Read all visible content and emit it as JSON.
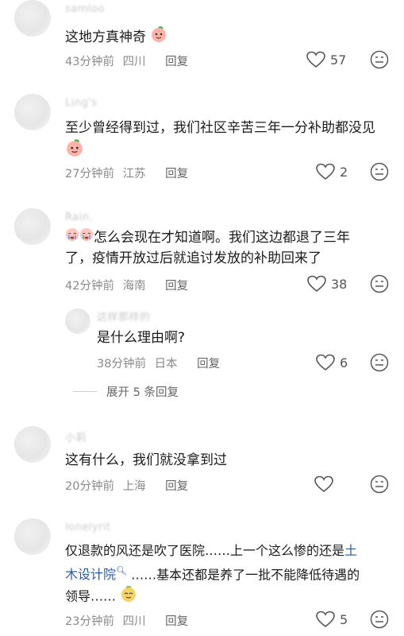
{
  "comments": [
    {
      "user": "samloo",
      "text": "这地方真神奇",
      "time": "43分钟前",
      "location": "四川",
      "reply": "回复",
      "likes": "57"
    },
    {
      "user": "Ling's",
      "text": "至少曾经得到过，我们社区辛苦三年一分补助都没见",
      "time": "27分钟前",
      "location": "江苏",
      "reply": "回复",
      "likes": "2"
    },
    {
      "user": "Rain.",
      "text_line1": "怎么会现在才知道啊。我们这边都退了三年",
      "text_line2": "了，疫情开放过后就追讨发放的补助回来了",
      "time": "42分钟前",
      "location": "海南",
      "reply": "回复",
      "likes": "38",
      "sub_reply": {
        "user": "这样那样的",
        "text": "是什么理由啊?",
        "time": "38分钟前",
        "location": "日本",
        "reply": "回复",
        "likes": "6"
      },
      "expand": "展开 5 条回复"
    },
    {
      "user": "小莉",
      "text": "这有什么，我们就没拿到过",
      "time": "20分钟前",
      "location": "上海",
      "reply": "回复",
      "likes": ""
    },
    {
      "user": "lonelyrit",
      "text_part1": "仅退款的风还是吹了医院……上一个这么惨的还是",
      "text_link1": "土",
      "text_link2": "木设计院",
      "text_part2": "……基本还都是养了一批不能降低待遇的",
      "text_part3": "领导……",
      "time": "23分钟前",
      "location": "四川",
      "reply": "回复",
      "likes": "5"
    }
  ]
}
